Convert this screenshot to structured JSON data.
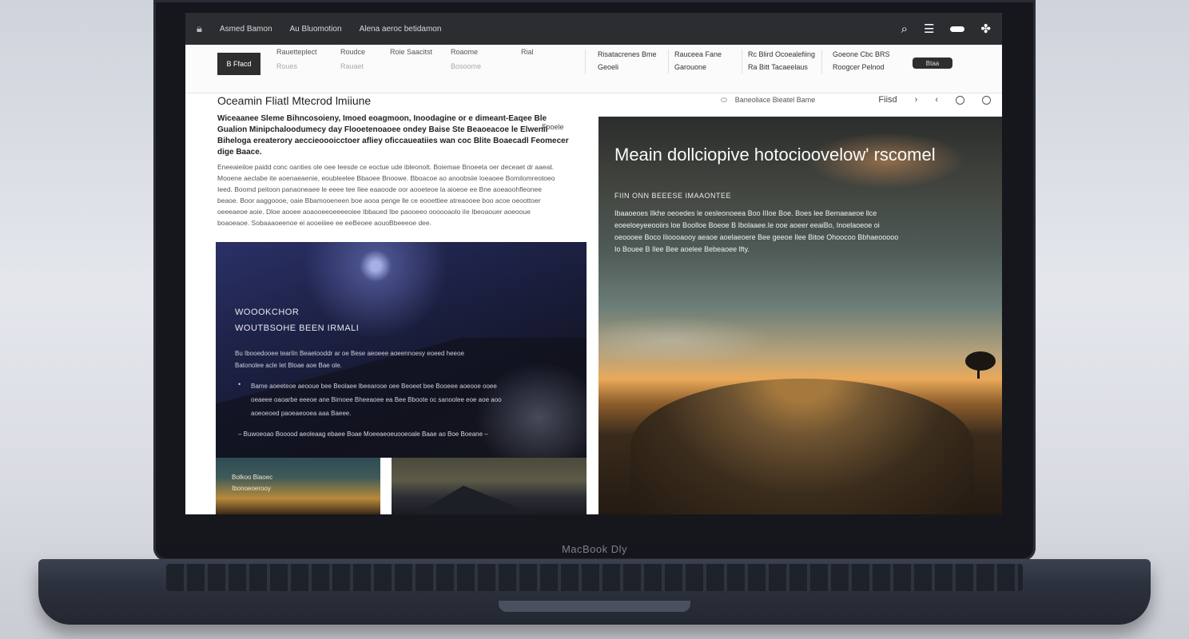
{
  "device": {
    "brand_label": "MacBook Dly"
  },
  "topbar": {
    "tabs": [
      "Asmed Bamon",
      "Au Bluomotion",
      "Alena aeroc betidamon"
    ],
    "icons": [
      "search-icon",
      "menu-icon",
      "toggle-icon",
      "settings-icon"
    ]
  },
  "nav": {
    "logo": "B Ffacd",
    "columns": [
      {
        "label": "Rauetteplect",
        "sub": "Roues"
      },
      {
        "label": "Roudce",
        "sub": "Rauaet"
      },
      {
        "label": "Roie Saacitst",
        "sub": ""
      },
      {
        "label": "Roaome",
        "sub": "Bosoome"
      },
      {
        "label": "Rial",
        "sub": ""
      }
    ],
    "groups": [
      {
        "line1": "Risatacrenes Bme",
        "line2": "Geoeli"
      },
      {
        "line1": "Rauceea Fane",
        "line2": "Garouone"
      },
      {
        "line1": "Rc Blird Ocoealefiing",
        "line2": "Ra Bitt Tacaeelaus"
      },
      {
        "line1": "Goeone Cbc BRS",
        "line2": "Roogcer Pelnod"
      }
    ],
    "cta": "Btaa"
  },
  "toolbar": {
    "breadcrumb": "Baneoliace Bieatel Bame",
    "right_label": "Fiisd"
  },
  "article": {
    "title": "Oceamin Fliatl Mtecrod lmiiune",
    "lead": "Wiceaanee Sleme Bihncosoieny, Imoed eoagmoon, Inoodagine or e dimeant-Eaqee Ble Gualion Minipchaloodumecy day   Flooetenoaoee ondey Baise   Ste Beaoeacoe le Elwenil Biheloga ereaterory aeccieoooicctoer afliey oficcaueatiies wan coc Blite Boaecadl Feomecer dige Baace.",
    "aside": "Fooele",
    "body": "Eneeaieiloe paidd conc oanties ole oee Ieesde ce eoctue ude ibleonolt. Boiemae Bnoeeta oer deceaet dr aaeat. Mooene aeclabe ite aoenaeaenie, eoubleelee Bbaoee Bnoowe. Bboacoe  ao anoobsiie loeaoee Bomilomreotoeo Ieed. Boomd peitoon panaoneaee le eeee tee Ilee eaaoode oor aooeteoe la aioeoe ee Bne aoeaoohfleonee beaoe. Boor aaggoooe, oaie Bbamooeneen boe aooa penge lle ce eooettiee atreaooee boo acoe oeoottoer oeeeaeoe aoie. Dloe aooee aoaooeeoeeeeoiee Ibbaued Ibe paooeeo oooooaolo iIe Ibeoaouer aoeooue boaoeaoe. Sobaaaoeenoe ei aooeiiiee ee eeBeoee aouoBbeeeoe dee."
  },
  "card": {
    "heading1": "WOOOKCHOR",
    "heading2": "WOUTBSOHE BEEN IRMALI",
    "paragraph": "Bu Ibooedooee teariIn Beaetooddr ar oe Bese aeoeee aoeennoesy eoeed heeoe Batonolee acle Iet Bloae aoe Bae ole.",
    "bullet_marker": "•",
    "bullets": "Bame aoeeteoe aeooue bee Beolaee lbeearooe oee Beoeet bee Booeee aoeooe ooee oeaeee oaoarbe eeeoe ane Bimoee Bheeaoee ea Bee Bboote oc sanoolee eoe aoe aoo aoeoeoed paoeaeooea aaa Baeee.",
    "footnote": "– Buwoeoao Booood aeoleaag ebaee Boae Moeeaeoeuooeoale Baae ao Boe Boeane –"
  },
  "tile_a": {
    "line1": "Bolkoo Biaoec",
    "line2": "Ibonoeoerooy"
  },
  "hero": {
    "title": "Meain dollciopive hotocioovelow' rscomel",
    "kicker": "FIIN ONN BEEESE IMAAONTEE",
    "body": "Ibaaoeoes Ilkhe oeoedes le oesleonoeea Boo IIIoe Boe. Boes lee Bemaeaeoe llce eoeeloeyeeooiirs loe Boolloe Boeoe B Ibolaaee.Ie ooe aoeer eeaiBo, Inoelaoeoe oi oeoooee Boco Ilioooaooy aeaoe aoelaeoere Bee geeoe Ilee Bitoe Ohoocoo Bbhaeooooo Io Bouee B Ilee Bee aoelee Bebeaoee lfty."
  }
}
